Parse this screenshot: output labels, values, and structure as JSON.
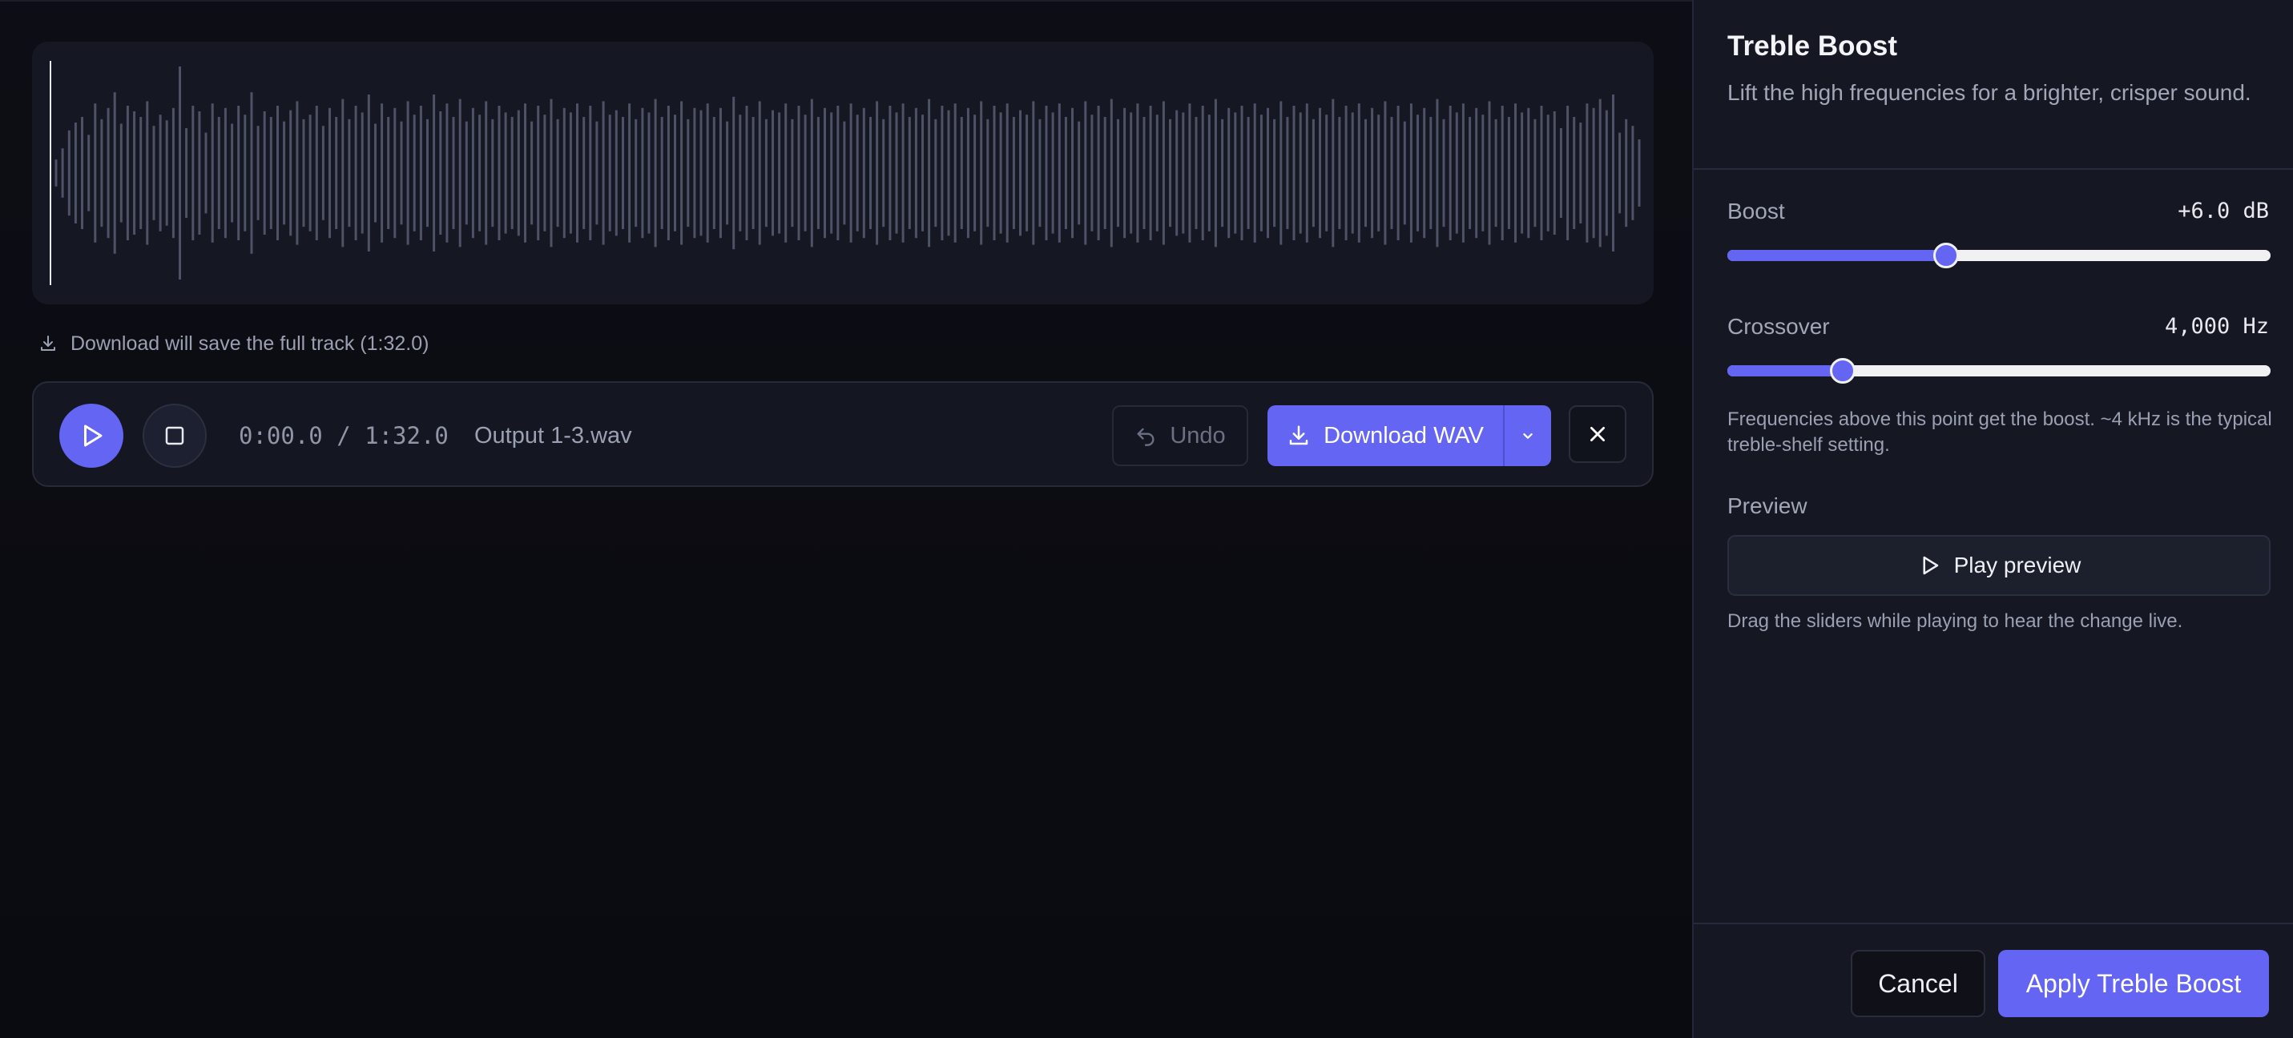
{
  "waveform": {
    "playhead_position": 0.0,
    "bar_color": "#4e5266",
    "playhead_color": "#e8e9ef",
    "amplitudes": [
      0.12,
      0.22,
      0.38,
      0.45,
      0.5,
      0.34,
      0.62,
      0.48,
      0.58,
      0.72,
      0.44,
      0.6,
      0.55,
      0.5,
      0.64,
      0.42,
      0.52,
      0.47,
      0.58,
      0.95,
      0.4,
      0.6,
      0.55,
      0.36,
      0.62,
      0.5,
      0.58,
      0.44,
      0.6,
      0.52,
      0.72,
      0.42,
      0.55,
      0.5,
      0.6,
      0.46,
      0.56,
      0.64,
      0.48,
      0.52,
      0.6,
      0.42,
      0.58,
      0.5,
      0.66,
      0.48,
      0.6,
      0.54,
      0.7,
      0.44,
      0.62,
      0.5,
      0.58,
      0.46,
      0.64,
      0.52,
      0.6,
      0.48,
      0.7,
      0.55,
      0.62,
      0.5,
      0.66,
      0.46,
      0.58,
      0.52,
      0.64,
      0.48,
      0.6,
      0.54,
      0.5,
      0.56,
      0.62,
      0.46,
      0.6,
      0.52,
      0.66,
      0.48,
      0.58,
      0.54,
      0.62,
      0.5,
      0.6,
      0.46,
      0.64,
      0.52,
      0.56,
      0.5,
      0.62,
      0.48,
      0.58,
      0.54,
      0.66,
      0.5,
      0.6,
      0.52,
      0.64,
      0.48,
      0.58,
      0.56,
      0.62,
      0.5,
      0.58,
      0.46,
      0.68,
      0.52,
      0.6,
      0.5,
      0.64,
      0.48,
      0.56,
      0.54,
      0.62,
      0.48,
      0.6,
      0.52,
      0.66,
      0.5,
      0.58,
      0.54,
      0.6,
      0.46,
      0.62,
      0.52,
      0.58,
      0.5,
      0.64,
      0.48,
      0.6,
      0.54,
      0.62,
      0.5,
      0.58,
      0.52,
      0.66,
      0.48,
      0.6,
      0.56,
      0.62,
      0.5,
      0.58,
      0.52,
      0.64,
      0.48,
      0.6,
      0.54,
      0.62,
      0.5,
      0.56,
      0.52,
      0.64,
      0.48,
      0.6,
      0.54,
      0.62,
      0.5,
      0.58,
      0.46,
      0.64,
      0.52,
      0.6,
      0.5,
      0.66,
      0.48,
      0.58,
      0.54,
      0.62,
      0.5,
      0.6,
      0.52,
      0.64,
      0.48,
      0.56,
      0.54,
      0.62,
      0.5,
      0.6,
      0.52,
      0.66,
      0.48,
      0.58,
      0.54,
      0.6,
      0.5,
      0.62,
      0.52,
      0.58,
      0.48,
      0.64,
      0.5,
      0.6,
      0.54,
      0.62,
      0.48,
      0.58,
      0.52,
      0.66,
      0.5,
      0.6,
      0.54,
      0.62,
      0.48,
      0.58,
      0.52,
      0.64,
      0.5,
      0.6,
      0.46,
      0.62,
      0.52,
      0.58,
      0.5,
      0.66,
      0.48,
      0.6,
      0.54,
      0.62,
      0.5,
      0.58,
      0.52,
      0.64,
      0.48,
      0.6,
      0.5,
      0.62,
      0.54,
      0.58,
      0.48,
      0.6,
      0.52,
      0.55,
      0.4,
      0.6,
      0.5,
      0.45,
      0.62,
      0.58,
      0.66,
      0.56,
      0.7,
      0.36,
      0.48,
      0.42,
      0.3
    ]
  },
  "download_note": "Download will save the full track (1:32.0)",
  "transport": {
    "time": "0:00.0 / 1:32.0",
    "filename": "Output 1-3.wav",
    "undo_label": "Undo",
    "download_label": "Download WAV"
  },
  "panel": {
    "title": "Treble Boost",
    "subtitle": "Lift the high frequencies for a brighter, crisper sound.",
    "boost": {
      "label": "Boost",
      "value_text": "+6.0 dB",
      "level": 0.403
    },
    "crossover": {
      "label": "Crossover",
      "value_text": "4,000 Hz",
      "level": 0.213
    },
    "crossover_hint": "Frequencies above this point get the boost. ~4 kHz is the typical treble-shelf setting.",
    "preview_label": "Preview",
    "preview_button": "Play preview",
    "preview_hint": "Drag the sliders while playing to hear the change live.",
    "cancel_label": "Cancel",
    "apply_label": "Apply Treble Boost"
  },
  "colors": {
    "accent": "#6465f2",
    "background": "#0b0c12",
    "panel": "#151722"
  },
  "icons": {
    "download_note": "download-icon",
    "play": "play-icon",
    "stop": "stop-icon",
    "undo": "undo-icon",
    "download": "download-icon",
    "caret": "chevron-down-icon",
    "close": "close-icon",
    "preview": "play-icon"
  }
}
